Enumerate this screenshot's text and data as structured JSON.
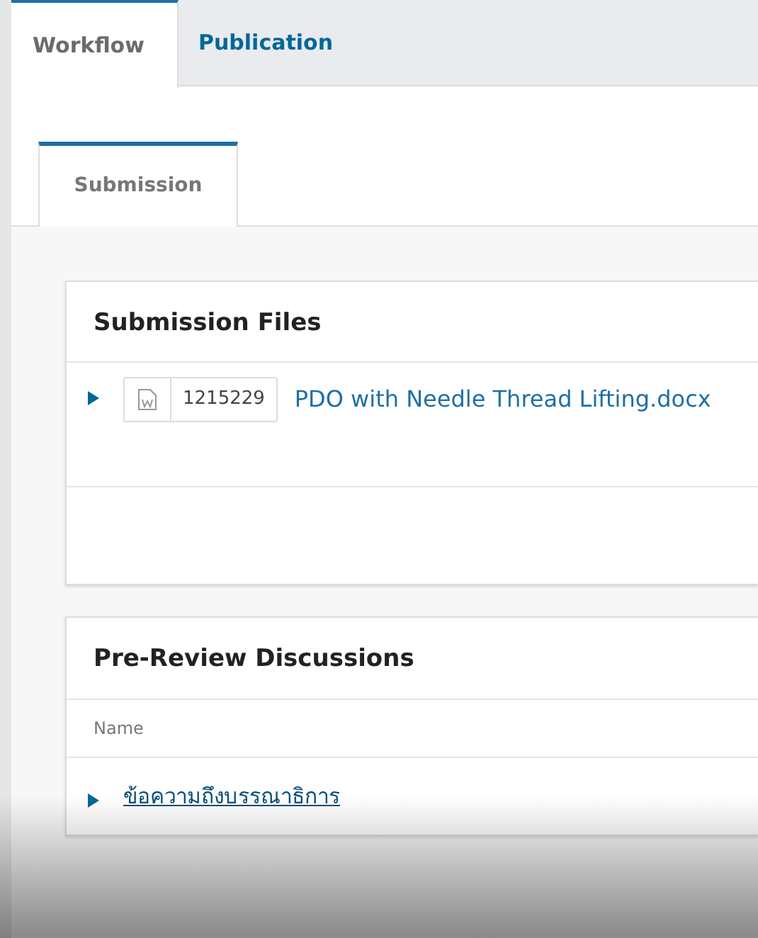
{
  "tabs": [
    {
      "label": "Workflow",
      "selected": true
    },
    {
      "label": "Publication",
      "selected": false
    }
  ],
  "stage_tabs": [
    {
      "label": "Submission",
      "selected": true
    }
  ],
  "submission_files": {
    "title": "Submission Files",
    "files": [
      {
        "expanded": false,
        "id": "1215229",
        "name": "PDO with Needle Thread Lifting.docx"
      }
    ]
  },
  "discussions": {
    "title": "Pre-Review Discussions",
    "columns": [
      "Name"
    ],
    "rows": [
      {
        "expanded": false,
        "name": "ข้อความถึงบรรณาธิการ"
      }
    ]
  }
}
